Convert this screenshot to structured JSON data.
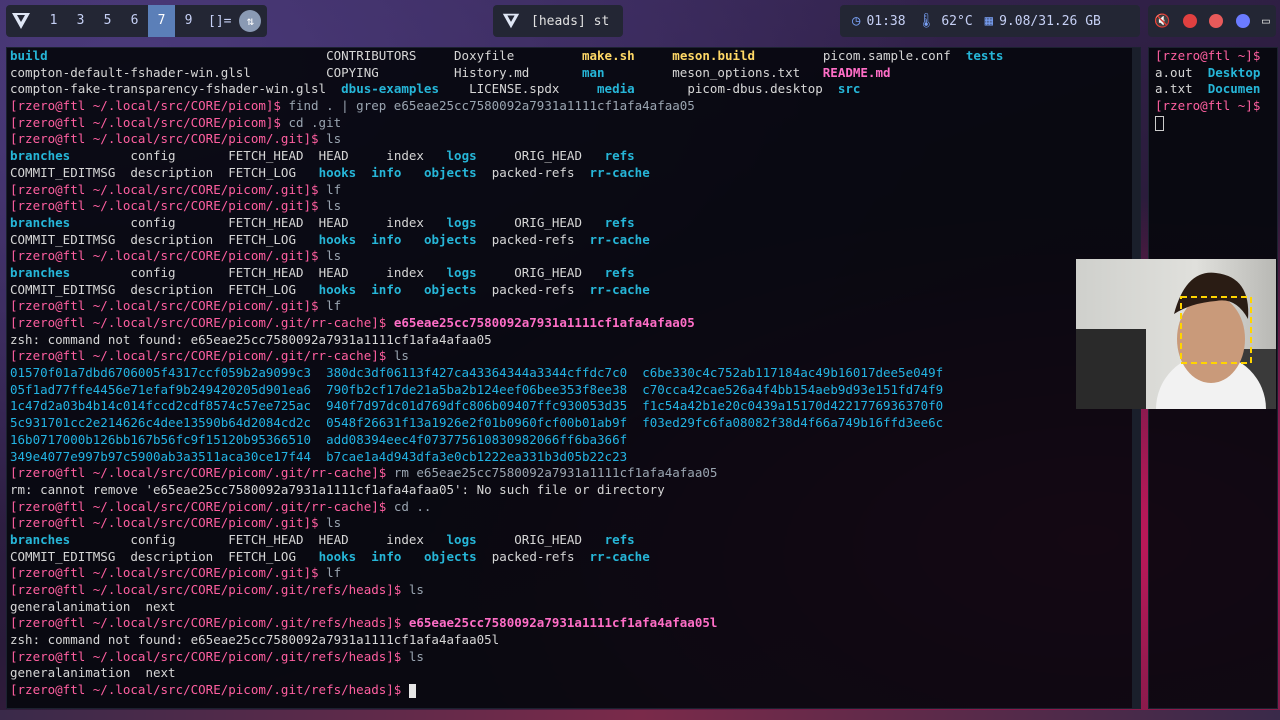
{
  "topbar": {
    "workspaces": [
      "1",
      "3",
      "5",
      "6",
      "7",
      "9"
    ],
    "active_workspace": "7",
    "layout_symbol": "[]=",
    "window_title": "[heads] st",
    "clock": "01:38",
    "temperature": "62°C",
    "memory": "9.08/31.26 GB"
  },
  "term_main": {
    "lines": [
      [
        [
          "t",
          "build",
          "d"
        ],
        [
          "t",
          "                                     CONTRIBUTORS     Doxyfile         ",
          ""
        ],
        [
          "t",
          "make.sh",
          "gy"
        ],
        [
          "t",
          "     ",
          ""
        ],
        [
          "t",
          "meson.build",
          "gy"
        ],
        [
          "t",
          "         picom.sample.conf  ",
          ""
        ],
        [
          "t",
          "tests",
          "d"
        ]
      ],
      [
        [
          "t",
          "compton-default-fshader-win.glsl          COPYING          History.md       ",
          ""
        ],
        [
          "t",
          "man",
          "d"
        ],
        [
          "t",
          "         meson_options.txt   ",
          ""
        ],
        [
          "t",
          "README.md",
          "mg"
        ]
      ],
      [
        [
          "t",
          "compton-fake-transparency-fshader-win.glsl  ",
          ""
        ],
        [
          "t",
          "dbus-examples",
          "d"
        ],
        [
          "t",
          "    LICENSE.spdx     ",
          ""
        ],
        [
          "t",
          "media",
          "d"
        ],
        [
          "t",
          "       picom-dbus.desktop  ",
          ""
        ],
        [
          "t",
          "src",
          "d"
        ]
      ],
      [
        [
          "p",
          "[rzero@ftl ~/.local/src/CORE/picom]$ "
        ],
        [
          "t",
          "find . | grep e65eae25cc7580092a7931a1111cf1afa4afaa05",
          "cmdg"
        ]
      ],
      [
        [
          "p",
          "[rzero@ftl ~/.local/src/CORE/picom]$ "
        ],
        [
          "t",
          "cd .git",
          "cmdg"
        ]
      ],
      [
        [
          "p",
          "[rzero@ftl ~/.local/src/CORE/picom/.git]$ "
        ],
        [
          "t",
          "ls",
          "cmdg"
        ]
      ],
      [
        [
          "t",
          "branches",
          "d"
        ],
        [
          "t",
          "        config       FETCH_HEAD  HEAD     index   ",
          ""
        ],
        [
          "t",
          "logs",
          "d"
        ],
        [
          "t",
          "     ORIG_HEAD   ",
          ""
        ],
        [
          "t",
          "refs",
          "d"
        ]
      ],
      [
        [
          "t",
          "COMMIT_EDITMSG  description  FETCH_LOG   ",
          ""
        ],
        [
          "t",
          "hooks",
          "d"
        ],
        [
          "t",
          "  ",
          ""
        ],
        [
          "t",
          "info",
          "d"
        ],
        [
          "t",
          "   ",
          ""
        ],
        [
          "t",
          "objects",
          "d"
        ],
        [
          "t",
          "  packed-refs  ",
          ""
        ],
        [
          "t",
          "rr-cache",
          "d"
        ]
      ],
      [
        [
          "p",
          "[rzero@ftl ~/.local/src/CORE/picom/.git]$ "
        ],
        [
          "t",
          "lf",
          "cmdg"
        ]
      ],
      [
        [
          "p",
          "[rzero@ftl ~/.local/src/CORE/picom/.git]$ "
        ],
        [
          "t",
          "ls",
          "cmdg"
        ]
      ],
      [
        [
          "t",
          "branches",
          "d"
        ],
        [
          "t",
          "        config       FETCH_HEAD  HEAD     index   ",
          ""
        ],
        [
          "t",
          "logs",
          "d"
        ],
        [
          "t",
          "     ORIG_HEAD   ",
          ""
        ],
        [
          "t",
          "refs",
          "d"
        ]
      ],
      [
        [
          "t",
          "COMMIT_EDITMSG  description  FETCH_LOG   ",
          ""
        ],
        [
          "t",
          "hooks",
          "d"
        ],
        [
          "t",
          "  ",
          ""
        ],
        [
          "t",
          "info",
          "d"
        ],
        [
          "t",
          "   ",
          ""
        ],
        [
          "t",
          "objects",
          "d"
        ],
        [
          "t",
          "  packed-refs  ",
          ""
        ],
        [
          "t",
          "rr-cache",
          "d"
        ]
      ],
      [
        [
          "p",
          "[rzero@ftl ~/.local/src/CORE/picom/.git]$ "
        ],
        [
          "t",
          "ls",
          "cmdg"
        ]
      ],
      [
        [
          "t",
          "branches",
          "d"
        ],
        [
          "t",
          "        config       FETCH_HEAD  HEAD     index   ",
          ""
        ],
        [
          "t",
          "logs",
          "d"
        ],
        [
          "t",
          "     ORIG_HEAD   ",
          ""
        ],
        [
          "t",
          "refs",
          "d"
        ]
      ],
      [
        [
          "t",
          "COMMIT_EDITMSG  description  FETCH_LOG   ",
          ""
        ],
        [
          "t",
          "hooks",
          "d"
        ],
        [
          "t",
          "  ",
          ""
        ],
        [
          "t",
          "info",
          "d"
        ],
        [
          "t",
          "   ",
          ""
        ],
        [
          "t",
          "objects",
          "d"
        ],
        [
          "t",
          "  packed-refs  ",
          ""
        ],
        [
          "t",
          "rr-cache",
          "d"
        ]
      ],
      [
        [
          "p",
          "[rzero@ftl ~/.local/src/CORE/picom/.git]$ "
        ],
        [
          "t",
          "lf",
          "cmdg"
        ]
      ],
      [
        [
          "p",
          "[rzero@ftl ~/.local/src/CORE/picom/.git/rr-cache]$ "
        ],
        [
          "t",
          "e65eae25cc7580092a7931a1111cf1afa4afaa05",
          "mg"
        ]
      ],
      [
        [
          "t",
          "zsh: command not found: e65eae25cc7580092a7931a1111cf1afa4afaa05",
          ""
        ]
      ],
      [
        [
          "p",
          "[rzero@ftl ~/.local/src/CORE/picom/.git/rr-cache]$ "
        ],
        [
          "t",
          "ls",
          "cmdg"
        ]
      ],
      [
        [
          "t",
          "01570f01a7dbd6706005f4317ccf059b2a9099c3",
          "hs"
        ],
        [
          "t",
          "  ",
          ""
        ],
        [
          "t",
          "380dc3df06113f427ca43364344a3344cffdc7c0",
          "hs"
        ],
        [
          "t",
          "  ",
          ""
        ],
        [
          "t",
          "c6be330c4c752ab117184ac49b16017dee5e049f",
          "hs"
        ]
      ],
      [
        [
          "t",
          "05f1ad77ffe4456e71efaf9b249420205d901ea6",
          "hs"
        ],
        [
          "t",
          "  ",
          ""
        ],
        [
          "t",
          "790fb2cf17de21a5ba2b124eef06bee353f8ee38",
          "hs"
        ],
        [
          "t",
          "  ",
          ""
        ],
        [
          "t",
          "c70cca42cae526a4f4bb154aeb9d93e151fd74f9",
          "hs"
        ]
      ],
      [
        [
          "t",
          "1c47d2a03b4b14c014fccd2cdf8574c57ee725ac",
          "hs"
        ],
        [
          "t",
          "  ",
          ""
        ],
        [
          "t",
          "940f7d97dc01d769dfc806b09407ffc930053d35",
          "hs"
        ],
        [
          "t",
          "  ",
          ""
        ],
        [
          "t",
          "f1c54a42b1e20c0439a15170d4221776936370f0",
          "hs"
        ]
      ],
      [
        [
          "t",
          "5c931701cc2e214626c4dee13590b64d2084cd2c",
          "hs"
        ],
        [
          "t",
          "  ",
          ""
        ],
        [
          "t",
          "0548f26631f13a1926e2f01b0960fcf00b01ab9f",
          "hs"
        ],
        [
          "t",
          "  ",
          ""
        ],
        [
          "t",
          "f03ed29fc6fa08082f38d4f66a749b16ffd3ee6c",
          "hs"
        ]
      ],
      [
        [
          "t",
          "16b0717000b126bb167b56fc9f15120b95366510",
          "hs"
        ],
        [
          "t",
          "  ",
          ""
        ],
        [
          "t",
          "add08394eec4f073775610830982066ff6ba366f",
          "hs"
        ]
      ],
      [
        [
          "t",
          "349e4077e997b97c5900ab3a3511aca30ce17f44",
          "hs"
        ],
        [
          "t",
          "  ",
          ""
        ],
        [
          "t",
          "b7cae1a4d943dfa3e0cb1222ea331b3d05b22c23",
          "hs"
        ]
      ],
      [
        [
          "p",
          "[rzero@ftl ~/.local/src/CORE/picom/.git/rr-cache]$ "
        ],
        [
          "t",
          "rm e65eae25cc7580092a7931a1111cf1afa4afaa05",
          "cmdg"
        ]
      ],
      [
        [
          "t",
          "rm: cannot remove 'e65eae25cc7580092a7931a1111cf1afa4afaa05': No such file or directory",
          ""
        ]
      ],
      [
        [
          "p",
          "[rzero@ftl ~/.local/src/CORE/picom/.git/rr-cache]$ "
        ],
        [
          "t",
          "cd ..",
          "cmdg"
        ]
      ],
      [
        [
          "p",
          "[rzero@ftl ~/.local/src/CORE/picom/.git]$ "
        ],
        [
          "t",
          "ls",
          "cmdg"
        ]
      ],
      [
        [
          "t",
          "branches",
          "d"
        ],
        [
          "t",
          "        config       FETCH_HEAD  HEAD     index   ",
          ""
        ],
        [
          "t",
          "logs",
          "d"
        ],
        [
          "t",
          "     ORIG_HEAD   ",
          ""
        ],
        [
          "t",
          "refs",
          "d"
        ]
      ],
      [
        [
          "t",
          "COMMIT_EDITMSG  description  FETCH_LOG   ",
          ""
        ],
        [
          "t",
          "hooks",
          "d"
        ],
        [
          "t",
          "  ",
          ""
        ],
        [
          "t",
          "info",
          "d"
        ],
        [
          "t",
          "   ",
          ""
        ],
        [
          "t",
          "objects",
          "d"
        ],
        [
          "t",
          "  packed-refs  ",
          ""
        ],
        [
          "t",
          "rr-cache",
          "d"
        ]
      ],
      [
        [
          "p",
          "[rzero@ftl ~/.local/src/CORE/picom/.git]$ "
        ],
        [
          "t",
          "lf",
          "cmdg"
        ]
      ],
      [
        [
          "p",
          "[rzero@ftl ~/.local/src/CORE/picom/.git/refs/heads]$ "
        ],
        [
          "t",
          "ls",
          "cmdg"
        ]
      ],
      [
        [
          "t",
          "generalanimation  next",
          ""
        ]
      ],
      [
        [
          "p",
          "[rzero@ftl ~/.local/src/CORE/picom/.git/refs/heads]$ "
        ],
        [
          "t",
          "e65eae25cc7580092a7931a1111cf1afa4afaa05l",
          "mg"
        ]
      ],
      [
        [
          "t",
          "zsh: command not found: e65eae25cc7580092a7931a1111cf1afa4afaa05l",
          ""
        ]
      ],
      [
        [
          "p",
          "[rzero@ftl ~/.local/src/CORE/picom/.git/refs/heads]$ "
        ],
        [
          "t",
          "ls",
          "cmdg"
        ]
      ],
      [
        [
          "t",
          "generalanimation  next",
          ""
        ]
      ],
      [
        [
          "p",
          "[rzero@ftl ~/.local/src/CORE/picom/.git/refs/heads]$ "
        ],
        [
          "c",
          ""
        ]
      ]
    ]
  },
  "term_side": {
    "lines": [
      [
        [
          "p",
          "[rzero@ftl ~]$"
        ]
      ],
      [
        [
          "t",
          "a.out  ",
          ""
        ],
        [
          "t",
          "Desktop",
          "d"
        ]
      ],
      [
        [
          "t",
          "a.txt  ",
          ""
        ],
        [
          "t",
          "Documen",
          "d"
        ]
      ],
      [
        [
          "p",
          "[rzero@ftl ~]$"
        ]
      ],
      [
        [
          "o",
          ""
        ]
      ]
    ]
  },
  "colors": {
    "prompt": "#ff5fa0",
    "directory": "#26b6d8",
    "hash_file": "#23b4e4",
    "accent_ws": "#5b7fb8"
  },
  "icons": [
    "clock-icon",
    "thermometer-icon",
    "memory-icon",
    "mute-icon"
  ]
}
